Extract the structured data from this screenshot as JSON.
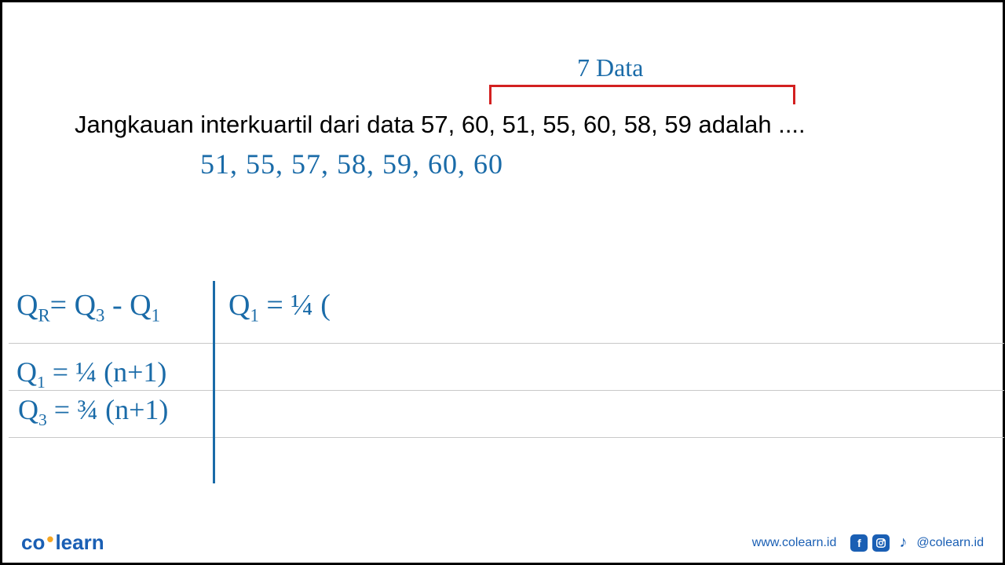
{
  "annotation": {
    "bracket_label": "7 Data"
  },
  "question": {
    "text": "Jangkauan interkuartil dari data 57, 60, 51, 55, 60, 58, 59 adalah  ...."
  },
  "work": {
    "sorted_data": "51, 55, 57, 58, 59, 60, 60",
    "formula_qr": "Q",
    "formula_qr_sub_r": "R",
    "formula_qr_eq": "= Q",
    "formula_qr_sub_3": "3",
    "formula_qr_minus": " - Q",
    "formula_qr_sub_1": "1",
    "formula_q1_left": "Q",
    "formula_q1_sub": "1",
    "formula_q1_eq": "= ¼ (n+1)",
    "formula_q3_left": "Q",
    "formula_q3_sub": "3",
    "formula_q3_eq": "= ¾ (n+1)",
    "formula_q1_right_left": "Q",
    "formula_q1_right_sub": "1",
    "formula_q1_right_eq": "= ¼ ("
  },
  "footer": {
    "logo_co": "co",
    "logo_learn": "learn",
    "url": "www.colearn.id",
    "handle": "@colearn.id"
  }
}
